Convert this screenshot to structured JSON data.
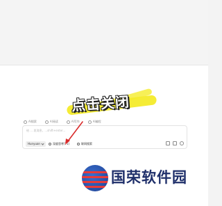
{
  "tool_tabs": [
    {
      "label": "AI搜索",
      "icon": "search-icon"
    },
    {
      "label": "AI阅读",
      "icon": "read-icon"
    },
    {
      "label": "AI写作",
      "icon": "write-icon"
    },
    {
      "label": "AI编程",
      "icon": "code-icon"
    }
  ],
  "callout": "点击关闭",
  "input": {
    "placeholder": "给 ... 发消息，...shift+enter..."
  },
  "model_select": {
    "value": "Hunyuan"
  },
  "chips": {
    "deep_think": "深度思考(T1)",
    "web_search": "联网搜索"
  },
  "watermark": {
    "text": "国荣软件园"
  },
  "colors": {
    "highlight": "#f4eb2a",
    "arrow": "#d92b2b",
    "logo_blue": "#1f2f6a",
    "logo_red": "#e53b3b"
  }
}
